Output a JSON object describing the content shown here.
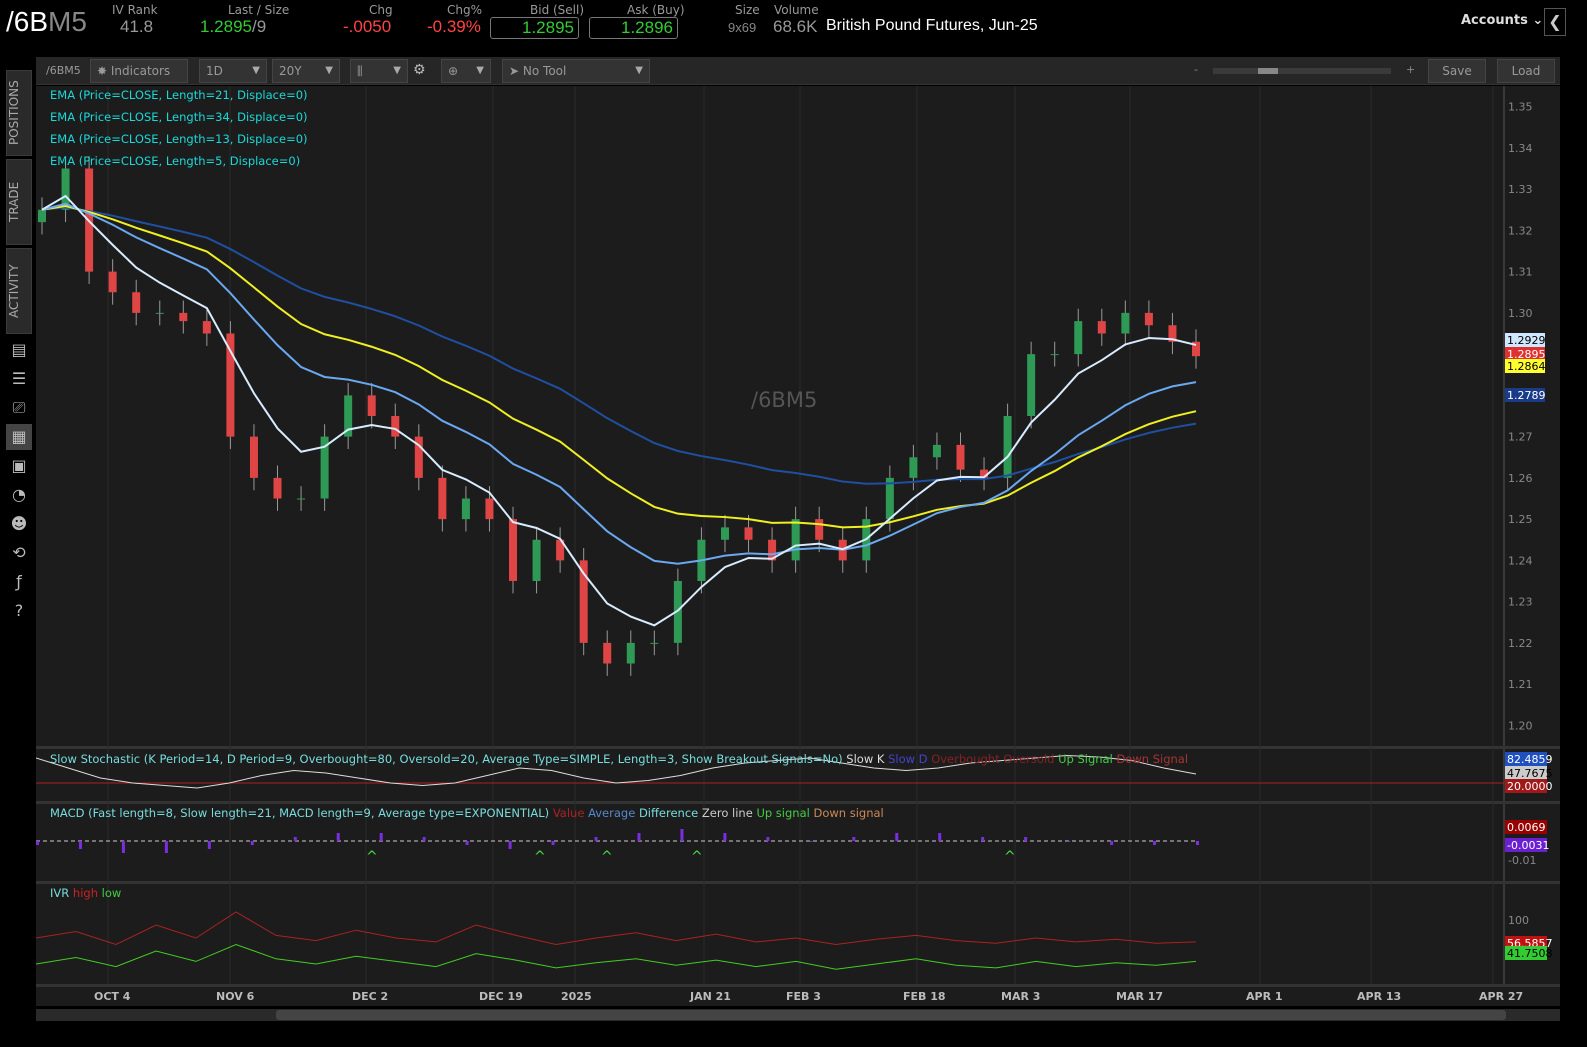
{
  "header": {
    "symbol_a": "/6B",
    "symbol_b": "M5",
    "iv_rank_label": "IV Rank",
    "iv_rank": "41.8",
    "last_label": "Last / Size",
    "last": "1.2895",
    "last_size": "/9",
    "chg_label": "Chg",
    "chg": "-.0050",
    "chgp_label": "Chg%",
    "chgp": "-0.39%",
    "bid_label": "Bid (Sell)",
    "bid": "1.2895",
    "ask_label": "Ask (Buy)",
    "ask": "1.2896",
    "size_label": "Size",
    "size": "9x69",
    "volume_label": "Volume",
    "volume": "68.6K",
    "description": "British Pound Futures, Jun-25",
    "accounts": "Accounts"
  },
  "sidebar": {
    "tabs": [
      "POSITIONS",
      "TRADE",
      "ACTIVITY"
    ],
    "icons": [
      "news-icon",
      "list-icon",
      "tv-icon",
      "chart-icon",
      "grid-icon",
      "gauge-icon",
      "community-icon",
      "history-icon",
      "fx-icon",
      "help-icon"
    ]
  },
  "toolbar": {
    "symbol": "/6BM5",
    "indicators": "Indicators",
    "aggregation": "1D",
    "timeframe": "20Y",
    "drawing_tool": "No Tool",
    "zoom_minus": "-",
    "zoom_plus": "+",
    "save": "Save",
    "load": "Load"
  },
  "studies": {
    "ema": [
      "EMA (Price=CLOSE, Length=21, Displace=0)",
      "EMA (Price=CLOSE, Length=34, Displace=0)",
      "EMA (Price=CLOSE, Length=13, Displace=0)",
      "EMA (Price=CLOSE, Length=5, Displace=0)"
    ],
    "stoch": "Slow Stochastic (K Period=14, D Period=9, Overbought=80, Oversold=20, Average Type=SIMPLE, Length=3, Show Breakout Signals=No)",
    "stoch_legend": [
      "Slow K",
      "Slow D",
      "Overbought",
      "Oversold",
      "Up Signal",
      "Down Signal"
    ],
    "macd": "MACD (Fast length=8, Slow length=21, MACD length=9, Average type=EXPONENTIAL)",
    "macd_legend": [
      "Value",
      "Average",
      "Difference",
      "Zero line",
      "Up signal",
      "Down signal"
    ],
    "ivr": "IVR",
    "ivr_legend": [
      "high",
      "low"
    ]
  },
  "watermark": "/6BM5",
  "price_badges": [
    {
      "v": "1.2929",
      "c": "#cfe8ff",
      "t": "#000"
    },
    {
      "v": "1.2895",
      "c": "#e03030",
      "t": "#fff"
    },
    {
      "v": "1.2864",
      "c": "#ffff30",
      "t": "#000"
    },
    {
      "v": "1.2789",
      "c": "#1a3a8a",
      "t": "#fff"
    }
  ],
  "sub_badges": {
    "stoch": [
      "82.4859",
      "47.7675",
      "20.0000"
    ],
    "macd": [
      "0.0069",
      "-0.0031"
    ],
    "macd_tick": "-0.01",
    "ivr": [
      "56.5857",
      "41.7508"
    ],
    "ivr_tick": "100"
  },
  "chart_data": {
    "type": "candlestick",
    "ylim": [
      1.195,
      1.355
    ],
    "yticks": [
      "1.35",
      "1.34",
      "1.33",
      "1.32",
      "1.31",
      "1.30",
      "1.29",
      "1.28",
      "1.27",
      "1.26",
      "1.25",
      "1.24",
      "1.23",
      "1.22",
      "1.21",
      "1.20"
    ],
    "xticks": [
      "OCT 4",
      "NOV 6",
      "DEC 2",
      "DEC 19",
      "2025",
      "JAN 21",
      "FEB 3",
      "FEB 18",
      "MAR 3",
      "MAR 17",
      "APR 1",
      "APR 13",
      "APR 27"
    ],
    "closes": [
      1.325,
      1.335,
      1.31,
      1.305,
      1.3,
      1.3,
      1.298,
      1.295,
      1.27,
      1.26,
      1.255,
      1.255,
      1.27,
      1.28,
      1.275,
      1.27,
      1.26,
      1.25,
      1.255,
      1.25,
      1.235,
      1.245,
      1.24,
      1.22,
      1.215,
      1.22,
      1.22,
      1.235,
      1.245,
      1.248,
      1.245,
      1.24,
      1.25,
      1.245,
      1.24,
      1.25,
      1.26,
      1.265,
      1.268,
      1.262,
      1.26,
      1.275,
      1.29,
      1.29,
      1.298,
      1.295,
      1.3,
      1.297,
      1.293,
      1.2895
    ],
    "stoch_k": [
      80,
      60,
      40,
      30,
      25,
      20,
      30,
      45,
      55,
      50,
      40,
      30,
      25,
      30,
      45,
      60,
      55,
      40,
      30,
      35,
      45,
      60,
      70,
      75,
      80,
      70,
      60,
      55,
      60,
      70,
      75,
      80,
      85,
      82,
      75,
      60,
      48
    ],
    "macd_hist": [
      -1,
      -2,
      -3,
      -3,
      -2,
      -1,
      1,
      2,
      2,
      1,
      -1,
      -2,
      -1,
      1,
      2,
      3,
      2,
      1,
      0,
      1,
      2,
      2,
      1,
      1,
      0,
      -1,
      -1,
      -1
    ],
    "ivr_high": [
      60,
      65,
      55,
      70,
      60,
      80,
      62,
      58,
      66,
      60,
      57,
      70,
      62,
      55,
      60,
      64,
      58,
      63,
      57,
      60,
      55,
      59,
      62,
      58,
      56,
      60,
      57,
      59,
      56,
      57
    ],
    "ivr_low": [
      40,
      45,
      38,
      50,
      42,
      55,
      44,
      40,
      46,
      42,
      38,
      48,
      43,
      37,
      41,
      44,
      39,
      43,
      38,
      42,
      36,
      40,
      44,
      39,
      37,
      42,
      38,
      41,
      39,
      42
    ]
  }
}
